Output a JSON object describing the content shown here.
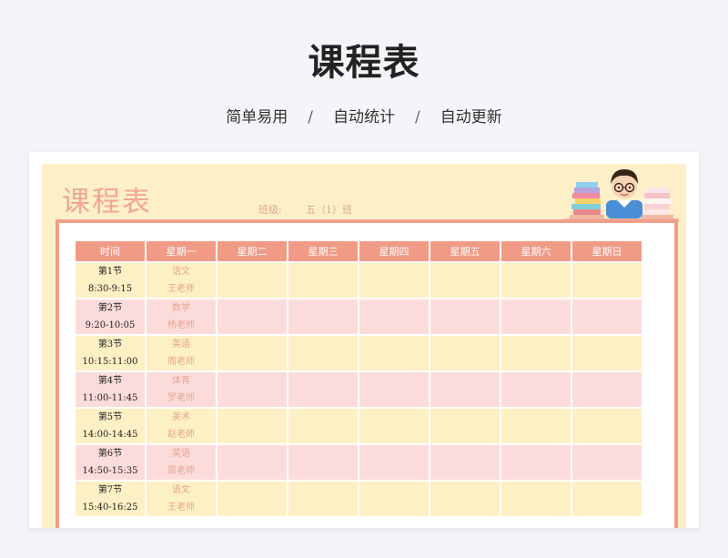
{
  "header": {
    "title": "课程表",
    "tags": [
      "简单易用",
      "自动统计",
      "自动更新"
    ],
    "separator": "/"
  },
  "sheet": {
    "title": "课程表",
    "class_label": "班级:",
    "class_value": "五（1）班",
    "columns": [
      "时间",
      "星期一",
      "星期二",
      "星期三",
      "星期四",
      "星期五",
      "星期六",
      "星期日"
    ],
    "rows": [
      {
        "period": "第1节",
        "time": "8:30-9:15",
        "subject": "语文",
        "teacher": "王老师"
      },
      {
        "period": "第2节",
        "time": "9:20-10:05",
        "subject": "数学",
        "teacher": "杨老师"
      },
      {
        "period": "第3节",
        "time": "10:15:11:00",
        "subject": "英语",
        "teacher": "周老师"
      },
      {
        "period": "第4节",
        "time": "11:00-11:45",
        "subject": "体育",
        "teacher": "罗老师"
      },
      {
        "period": "第5节",
        "time": "14:00-14:45",
        "subject": "美术",
        "teacher": "赵老师"
      },
      {
        "period": "第6节",
        "time": "14:50-15:35",
        "subject": "英语",
        "teacher": "周老师"
      },
      {
        "period": "第7节",
        "time": "15:40-16:25",
        "subject": "语文",
        "teacher": "王老师"
      }
    ]
  },
  "colors": {
    "header_bg": "#f19a85",
    "row_yellow": "#fdf0c4",
    "row_pink": "#fcdcdb",
    "title_color": "#f2a68e"
  }
}
